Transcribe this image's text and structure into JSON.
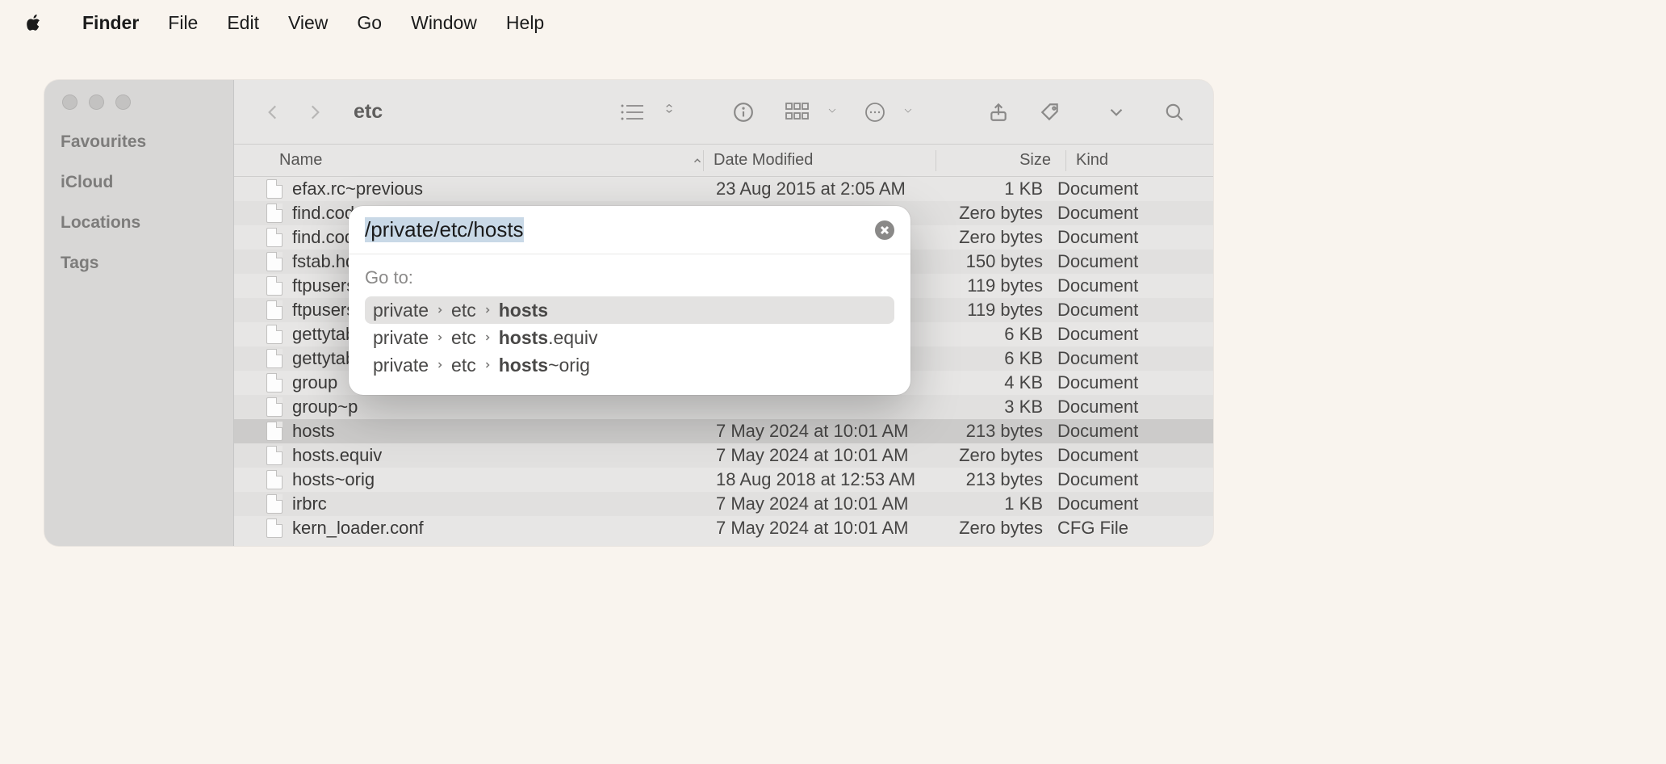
{
  "menubar": {
    "app": "Finder",
    "items": [
      "File",
      "Edit",
      "View",
      "Go",
      "Window",
      "Help"
    ]
  },
  "sidebar": {
    "sections": [
      "Favourites",
      "iCloud",
      "Locations",
      "Tags"
    ]
  },
  "window": {
    "title": "etc"
  },
  "columns": {
    "name": "Name",
    "date": "Date Modified",
    "size": "Size",
    "kind": "Kind"
  },
  "rows": [
    {
      "name": "efax.rc~previous",
      "date": "23 Aug 2015 at 2:05 AM",
      "size": "1 KB",
      "kind": "Document",
      "selected": false
    },
    {
      "name": "find.cod",
      "date": "",
      "size": "Zero bytes",
      "kind": "Document",
      "selected": false
    },
    {
      "name": "find.cod",
      "date": "",
      "size": "Zero bytes",
      "kind": "Document",
      "selected": false
    },
    {
      "name": "fstab.hd",
      "date": "",
      "size": "150 bytes",
      "kind": "Document",
      "selected": false
    },
    {
      "name": "ftpusers",
      "date": "",
      "size": "119 bytes",
      "kind": "Document",
      "selected": false
    },
    {
      "name": "ftpusers",
      "date": "",
      "size": "119 bytes",
      "kind": "Document",
      "selected": false
    },
    {
      "name": "gettytab",
      "date": "",
      "size": "6 KB",
      "kind": "Document",
      "selected": false
    },
    {
      "name": "gettytab",
      "date": "",
      "size": "6 KB",
      "kind": "Document",
      "selected": false
    },
    {
      "name": "group",
      "date": "",
      "size": "4 KB",
      "kind": "Document",
      "selected": false
    },
    {
      "name": "group~p",
      "date": "",
      "size": "3 KB",
      "kind": "Document",
      "selected": false
    },
    {
      "name": "hosts",
      "date": "7 May 2024 at 10:01 AM",
      "size": "213 bytes",
      "kind": "Document",
      "selected": true
    },
    {
      "name": "hosts.equiv",
      "date": "7 May 2024 at 10:01 AM",
      "size": "Zero bytes",
      "kind": "Document",
      "selected": false
    },
    {
      "name": "hosts~orig",
      "date": "18 Aug 2018 at 12:53 AM",
      "size": "213 bytes",
      "kind": "Document",
      "selected": false
    },
    {
      "name": "irbrc",
      "date": "7 May 2024 at 10:01 AM",
      "size": "1 KB",
      "kind": "Document",
      "selected": false
    },
    {
      "name": "kern_loader.conf",
      "date": "7 May 2024 at 10:01 AM",
      "size": "Zero bytes",
      "kind": "CFG File",
      "selected": false
    }
  ],
  "goto": {
    "value": "/private/etc/hosts",
    "label": "Go to:",
    "suggestions": [
      {
        "segments": [
          "private",
          "etc"
        ],
        "match": "hosts",
        "tail": "",
        "selected": true
      },
      {
        "segments": [
          "private",
          "etc"
        ],
        "match": "hosts",
        "tail": ".equiv",
        "selected": false
      },
      {
        "segments": [
          "private",
          "etc"
        ],
        "match": "hosts",
        "tail": "~orig",
        "selected": false
      }
    ]
  }
}
